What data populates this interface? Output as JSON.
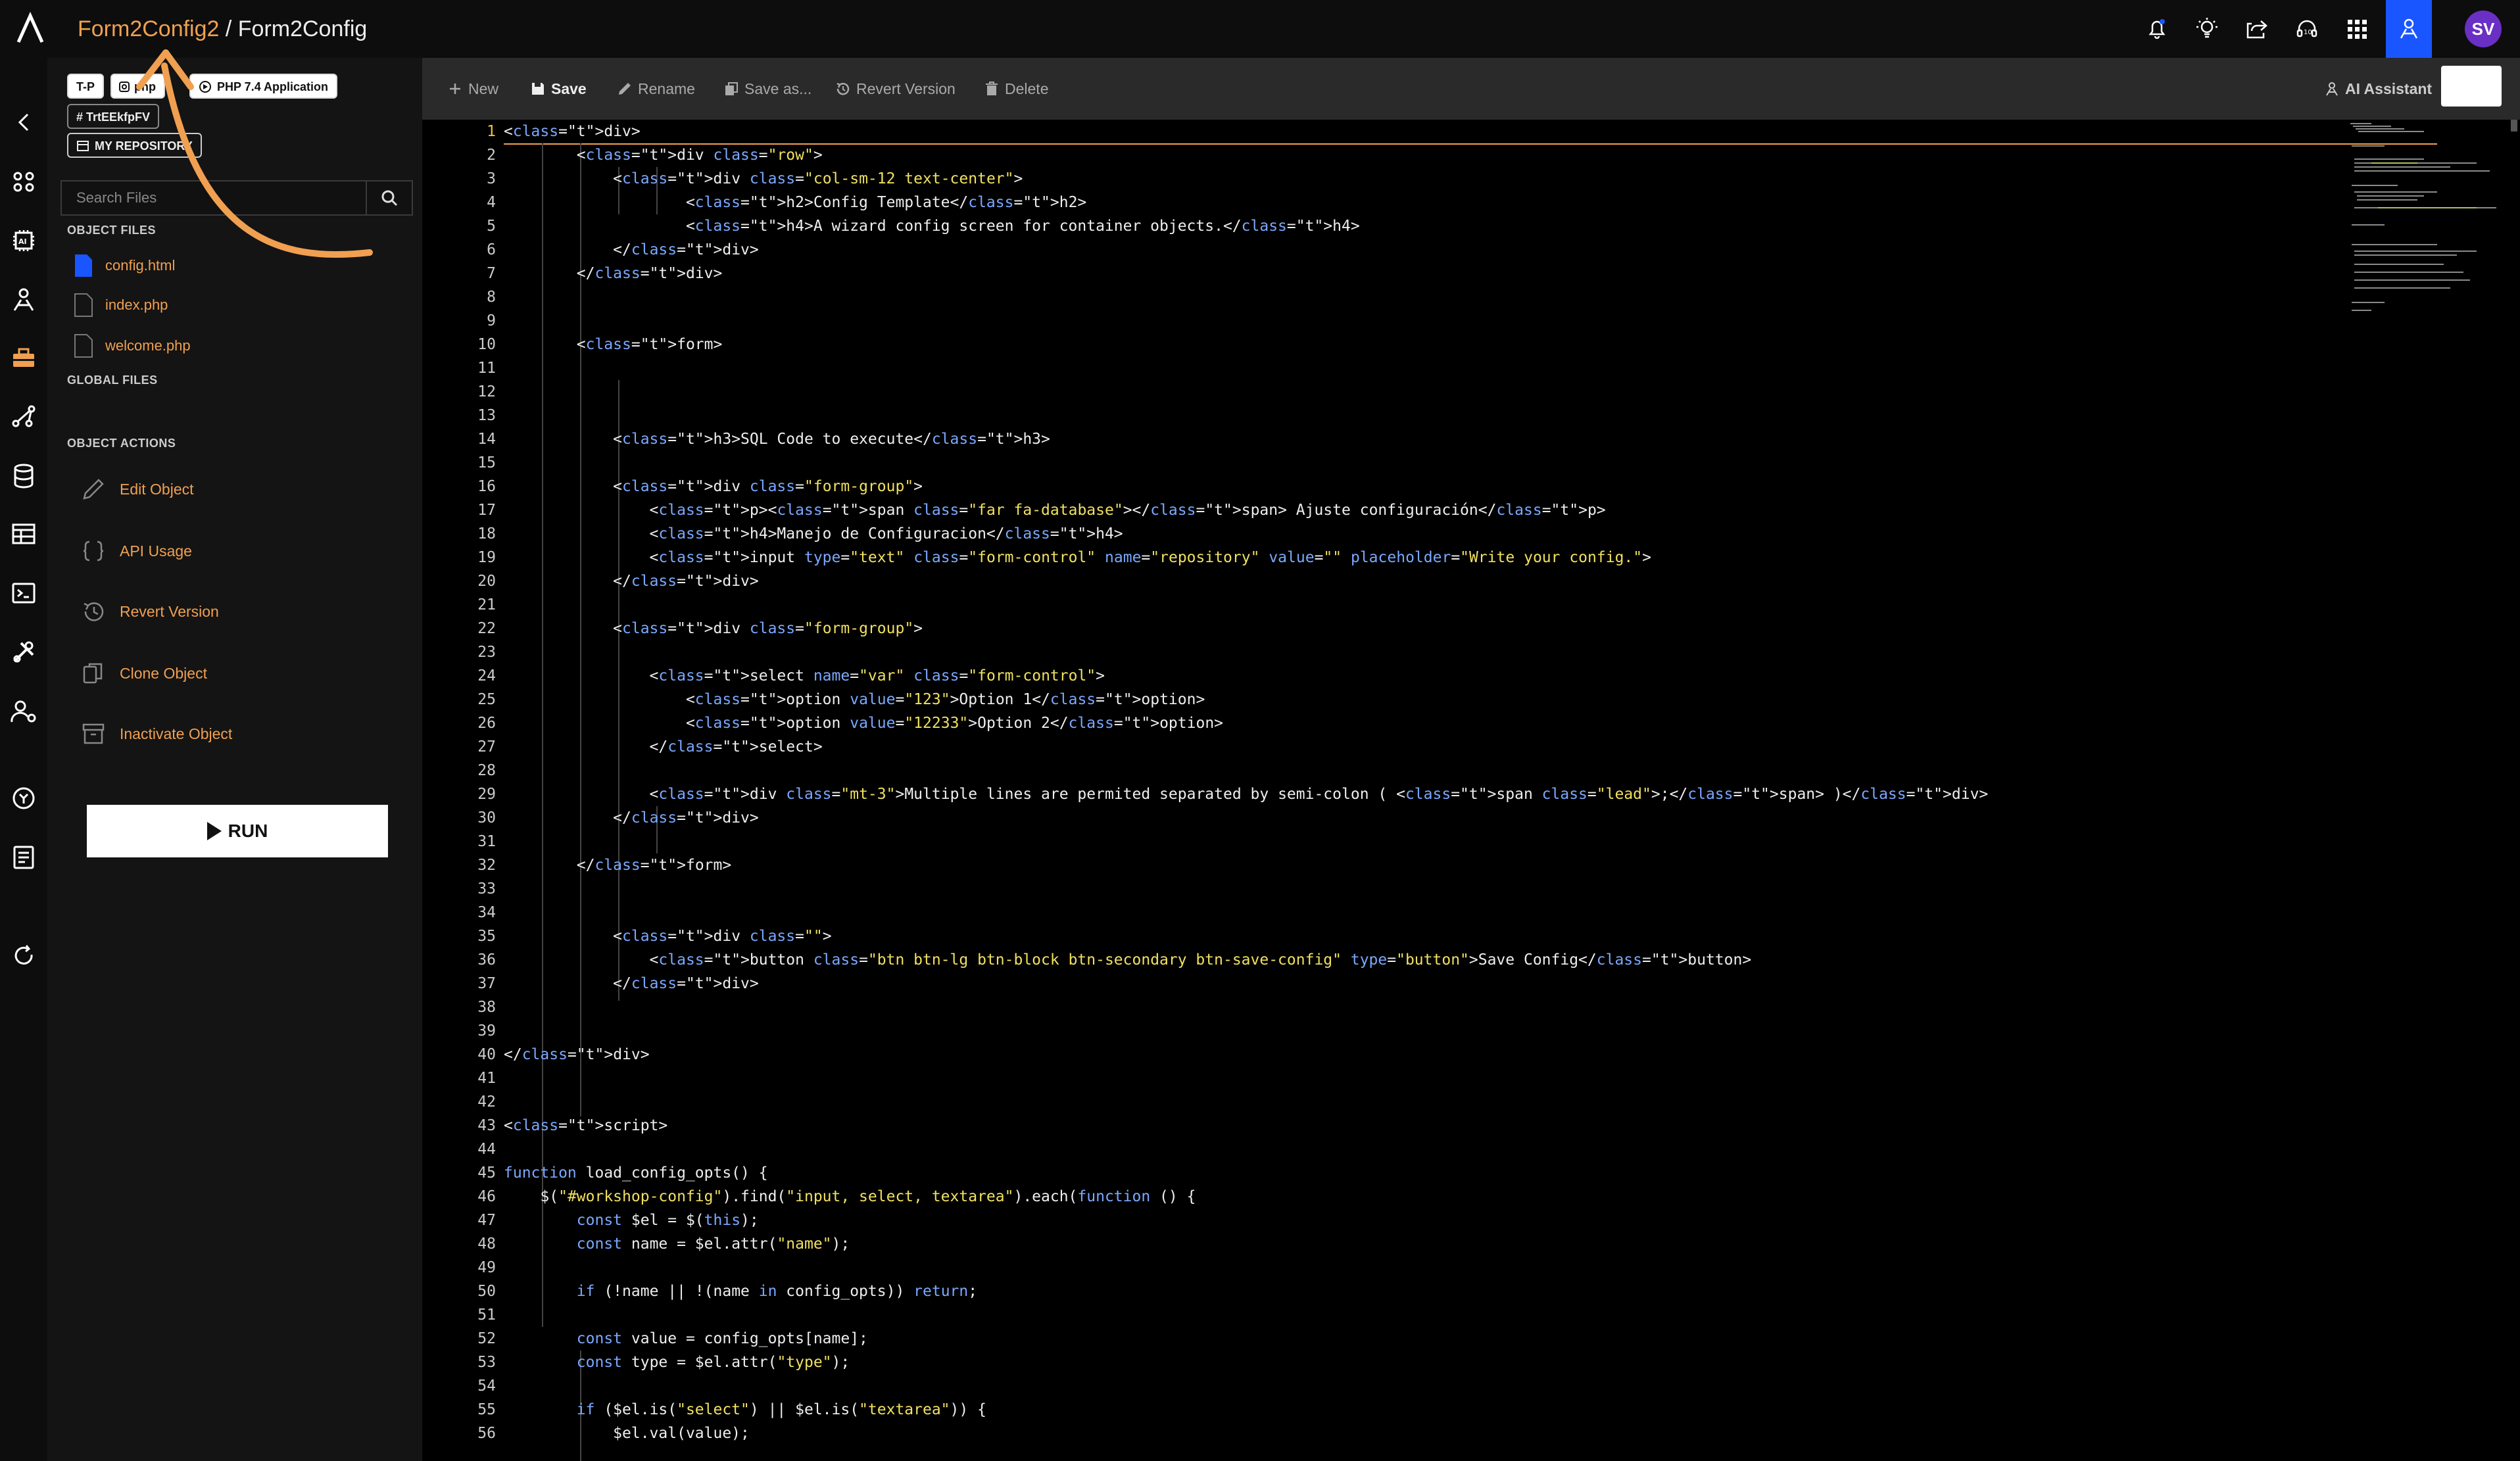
{
  "header": {
    "breadcrumb_parent": "Form2Config2",
    "breadcrumb_sep": " / ",
    "breadcrumb_current": "Form2Config",
    "avatar_initials": "SV",
    "icons": [
      "bell-icon",
      "lightbulb-icon",
      "share-icon",
      "support-icon",
      "apps-grid-icon",
      "ai-user-icon"
    ]
  },
  "sidebar": {
    "tags": [
      "T-P",
      "php",
      "PHP 7.4 Application",
      "TrtEEkfpFV",
      "MY REPOSITORY"
    ],
    "search_placeholder": "Search Files",
    "object_files_label": "OBJECT FILES",
    "files": [
      "config.html",
      "index.php",
      "welcome.php"
    ],
    "global_files_label": "GLOBAL FILES",
    "object_actions_label": "OBJECT ACTIONS",
    "actions": [
      "Edit Object",
      "API Usage",
      "Revert Version",
      "Clone Object",
      "Inactivate Object"
    ],
    "run_label": "RUN"
  },
  "toolbar": {
    "new": "New",
    "save": "Save",
    "rename": "Rename",
    "save_as": "Save as...",
    "revert": "Revert Version",
    "delete": "Delete",
    "ai_assistant": "AI Assistant"
  },
  "colors": {
    "accent": "#f0a050",
    "active": "#1a56ff",
    "avatar": "#6a2fc4"
  },
  "editor": {
    "current_line": 1,
    "lines": [
      "<div>",
      "        <div class=\"row\">",
      "            <div class=\"col-sm-12 text-center\">",
      "                    <h2>Config Template</h2>",
      "                    <h4>A wizard config screen for container objects.</h4>",
      "            </div>",
      "        </div>",
      "",
      "",
      "        <form>",
      "",
      "",
      "",
      "            <h3>SQL Code to execute</h3>",
      "",
      "            <div class=\"form-group\">",
      "                <p><span class=\"far fa-database\"></span> Ajuste configuración</p>",
      "                <h4>Manejo de Configuracion</h4>",
      "                <input type=\"text\" class=\"form-control\" name=\"repository\" value=\"\" placeholder=\"Write your config.\">",
      "            </div>",
      "",
      "            <div class=\"form-group\">",
      "",
      "                <select name=\"var\" class=\"form-control\">",
      "                    <option value=\"123\">Option 1</option>",
      "                    <option value=\"12233\">Option 2</option>",
      "                </select>",
      "",
      "                <div class=\"mt-3\">Multiple lines are permited separated by semi-colon ( <span class=\"lead\">;</span> )</div>",
      "            </div>",
      "",
      "        </form>",
      "",
      "",
      "            <div class=\"\">",
      "                <button class=\"btn btn-lg btn-block btn-secondary btn-save-config\" type=\"button\">Save Config</button>",
      "            </div>",
      "",
      "",
      "</div>",
      "",
      "",
      "<script>",
      "",
      "function load_config_opts() {",
      "    $(\"#workshop-config\").find(\"input, select, textarea\").each(function () {",
      "        const $el = $(this);",
      "        const name = $el.attr(\"name\");",
      "",
      "        if (!name || !(name in config_opts)) return;",
      "",
      "        const value = config_opts[name];",
      "        const type = $el.attr(\"type\");",
      "",
      "        if ($el.is(\"select\") || $el.is(\"textarea\")) {",
      "            $el.val(value);"
    ]
  }
}
